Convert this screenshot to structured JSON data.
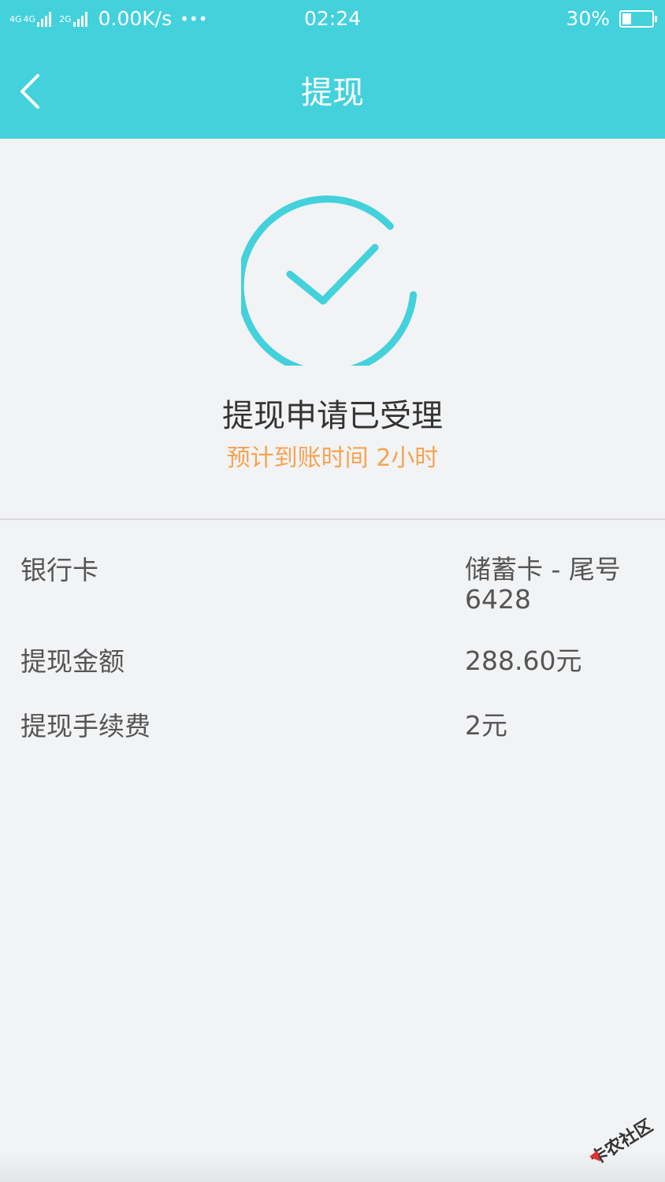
{
  "status_bar": {
    "network_1": "4G",
    "network_2": "4G",
    "network_3": "2G",
    "speed": "0.00K/s",
    "dots": "•••",
    "time": "02:24",
    "battery": "30%",
    "battery_level": 0.3
  },
  "nav": {
    "title": "提现"
  },
  "result": {
    "title": "提现申请已受理",
    "subtitle": "预计到账时间 2小时"
  },
  "details": [
    {
      "label": "银行卡",
      "value": "储蓄卡 - 尾号6428"
    },
    {
      "label": "提现金额",
      "value": "288.60元"
    },
    {
      "label": "提现手续费",
      "value": "2元"
    }
  ],
  "watermark": {
    "text": "卡农社区"
  },
  "colors": {
    "accent": "#43d1dc",
    "highlight": "#f5a451",
    "background": "#f2f3f5"
  }
}
